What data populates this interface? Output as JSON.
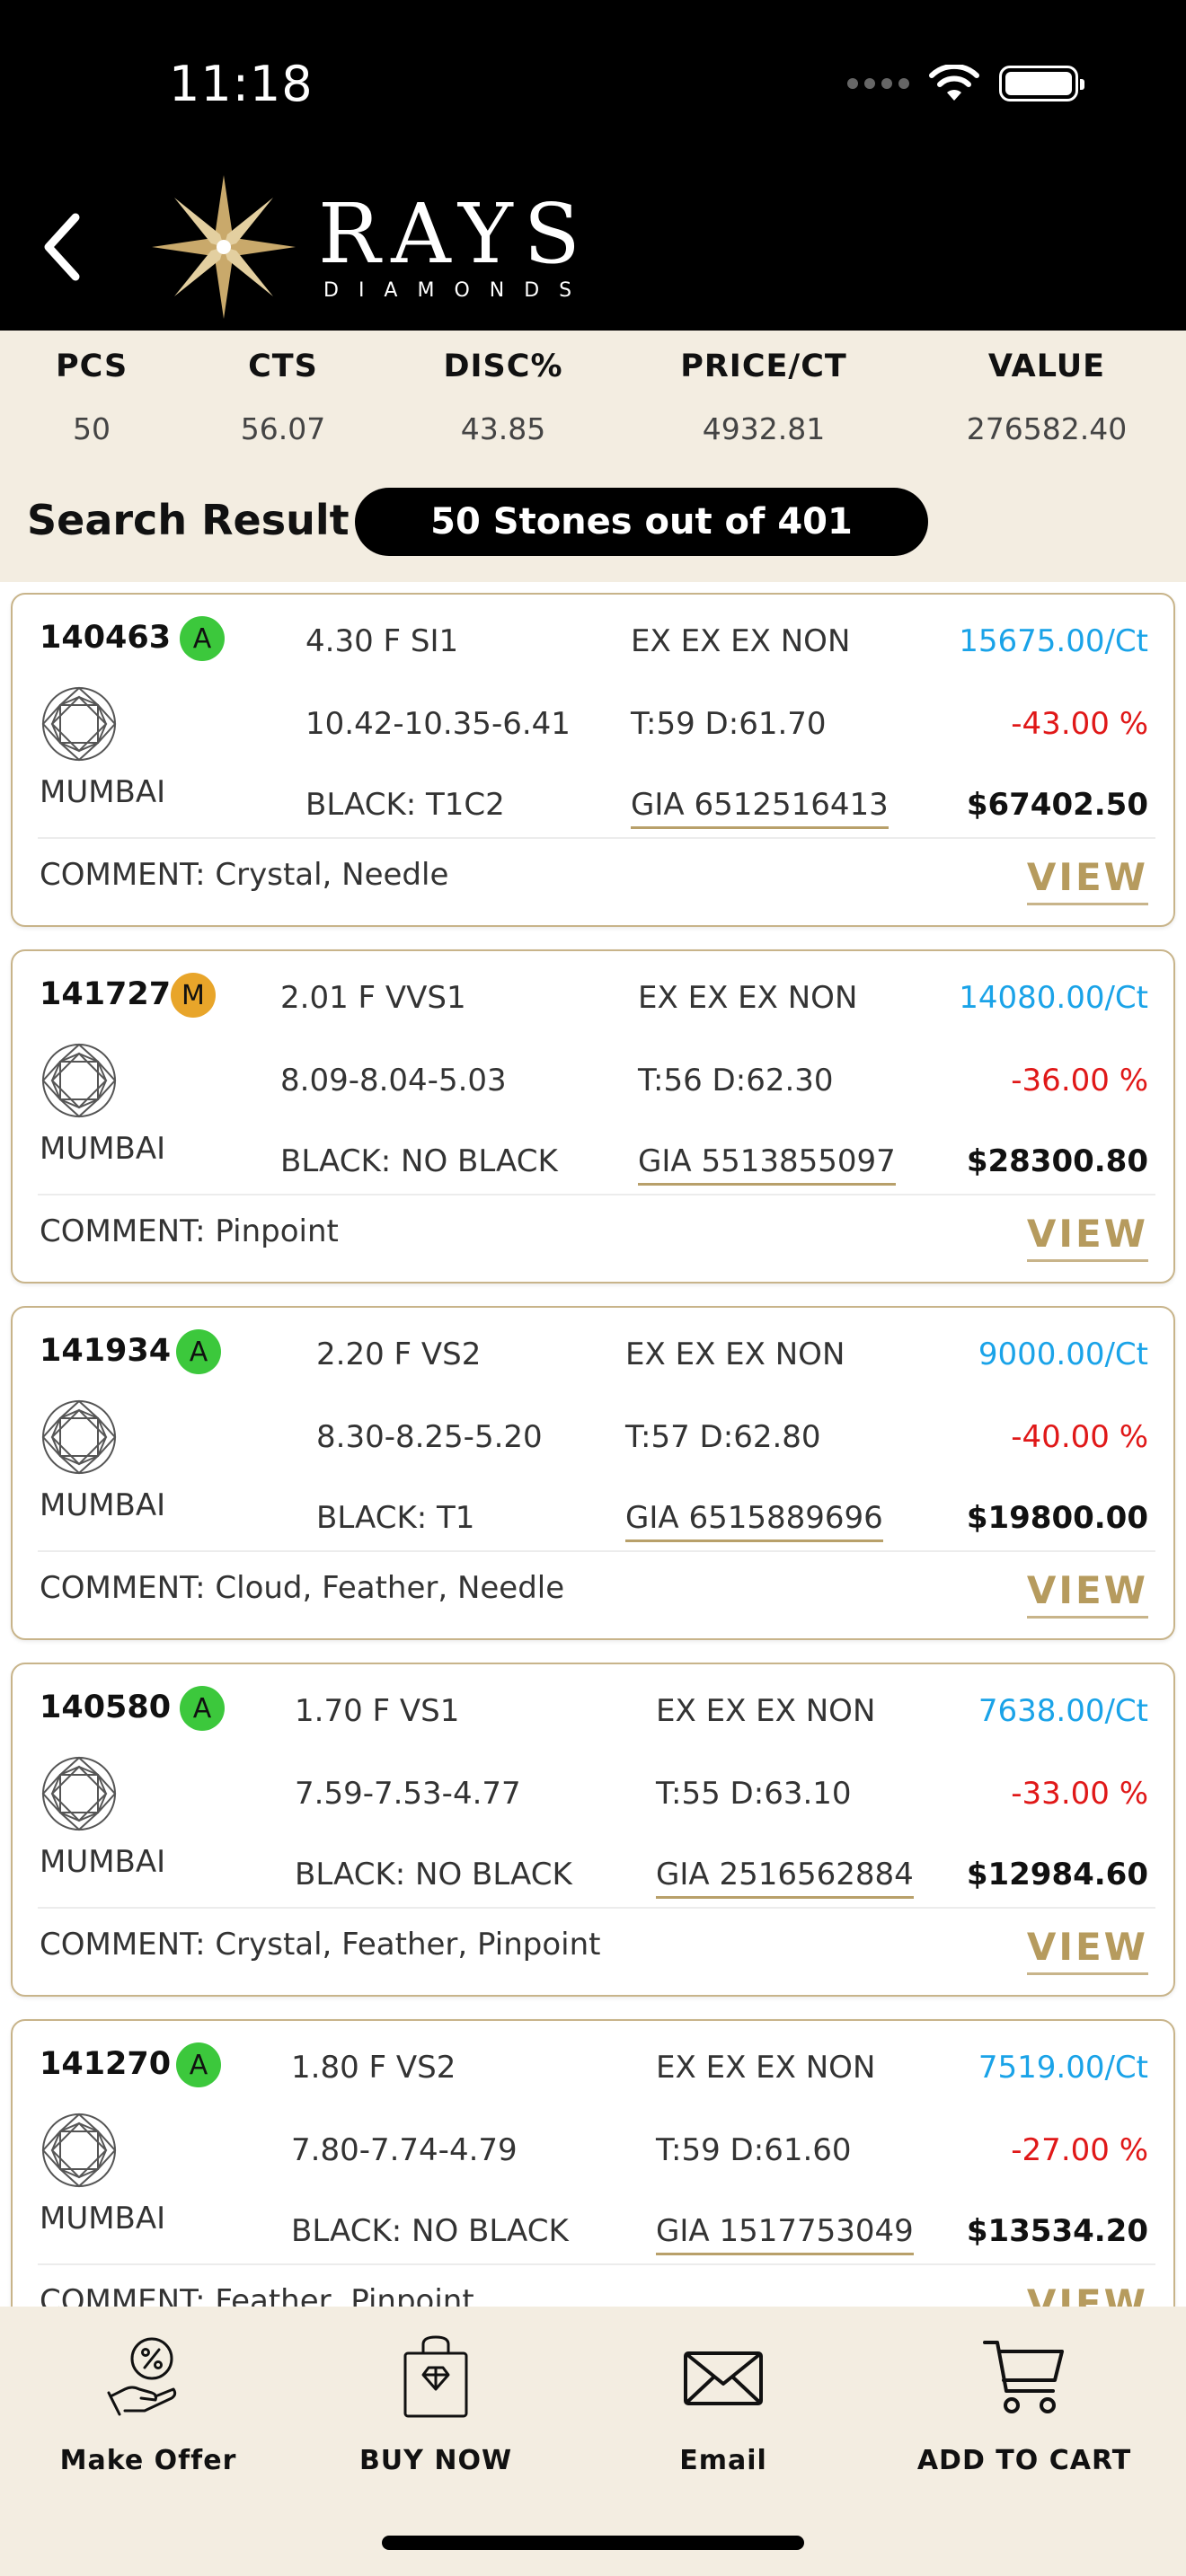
{
  "status_bar": {
    "time": "11:18"
  },
  "brand": {
    "name": "RAYS",
    "sub": "DIAMONDS"
  },
  "summary": {
    "columns": [
      {
        "label": "PCS",
        "value": "50"
      },
      {
        "label": "CTS",
        "value": "56.07"
      },
      {
        "label": "DISC%",
        "value": "43.85"
      },
      {
        "label": "PRICE/CT",
        "value": "4932.81"
      },
      {
        "label": "VALUE",
        "value": "276582.40"
      }
    ]
  },
  "search": {
    "title": "Search Result",
    "count_label": "50 Stones out of 401"
  },
  "stones": [
    {
      "id": "140463",
      "badge": "A",
      "shape_icon": "round-diamond-icon",
      "location": "MUMBAI",
      "spec": "4.30 F SI1",
      "measurements": "10.42-10.35-6.41",
      "black": "BLACK: T1C2",
      "cut": "EX EX EX NON",
      "table_depth": "T:59 D:61.70",
      "cert": "GIA 6512516413",
      "price_ct": "15675.00/Ct",
      "discount": "-43.00 %",
      "value": "$67402.50",
      "comment": "COMMENT: Crystal, Needle",
      "view_label": "VIEW"
    },
    {
      "id": "141727",
      "badge": "M",
      "shape_icon": "round-diamond-icon",
      "location": "MUMBAI",
      "spec": "2.01 F VVS1",
      "measurements": "8.09-8.04-5.03",
      "black": "BLACK: NO BLACK",
      "cut": "EX EX EX NON",
      "table_depth": "T:56 D:62.30",
      "cert": "GIA 5513855097",
      "price_ct": "14080.00/Ct",
      "discount": "-36.00 %",
      "value": "$28300.80",
      "comment": "COMMENT: Pinpoint",
      "view_label": "VIEW"
    },
    {
      "id": "141934",
      "badge": "A",
      "shape_icon": "round-diamond-icon",
      "location": "MUMBAI",
      "spec": "2.20 F VS2",
      "measurements": "8.30-8.25-5.20",
      "black": "BLACK: T1",
      "cut": "EX EX EX NON",
      "table_depth": "T:57 D:62.80",
      "cert": "GIA 6515889696",
      "price_ct": "9000.00/Ct",
      "discount": "-40.00 %",
      "value": "$19800.00",
      "comment": "COMMENT: Cloud, Feather, Needle",
      "view_label": "VIEW"
    },
    {
      "id": "140580",
      "badge": "A",
      "shape_icon": "round-diamond-icon",
      "location": "MUMBAI",
      "spec": "1.70 F VS1",
      "measurements": "7.59-7.53-4.77",
      "black": "BLACK: NO BLACK",
      "cut": "EX EX EX NON",
      "table_depth": "T:55 D:63.10",
      "cert": "GIA 2516562884",
      "price_ct": "7638.00/Ct",
      "discount": "-33.00 %",
      "value": "$12984.60",
      "comment": "COMMENT: Crystal, Feather, Pinpoint",
      "view_label": "VIEW"
    },
    {
      "id": "141270",
      "badge": "A",
      "shape_icon": "round-diamond-icon",
      "location": "MUMBAI",
      "spec": "1.80 F VS2",
      "measurements": "7.80-7.74-4.79",
      "black": "BLACK: NO BLACK",
      "cut": "EX EX EX NON",
      "table_depth": "T:59 D:61.60",
      "cert": "GIA 1517753049",
      "price_ct": "7519.00/Ct",
      "discount": "-27.00 %",
      "value": "$13534.20",
      "comment": "COMMENT: Feather, Pinpoint",
      "view_label": "VIEW"
    }
  ],
  "bottom_bar": {
    "items": [
      {
        "label": "Make Offer",
        "icon": "make-offer-icon"
      },
      {
        "label": "BUY NOW",
        "icon": "shopping-bag-icon"
      },
      {
        "label": "Email",
        "icon": "envelope-icon"
      },
      {
        "label": "ADD TO CART",
        "icon": "cart-icon"
      }
    ]
  },
  "colors": {
    "accent_gold": "#b69b5e",
    "price_blue": "#1aa3e8",
    "discount_red": "#e01818",
    "badge_green": "#3cc83c",
    "badge_orange": "#e8a52a",
    "background": "#f3ede1"
  }
}
